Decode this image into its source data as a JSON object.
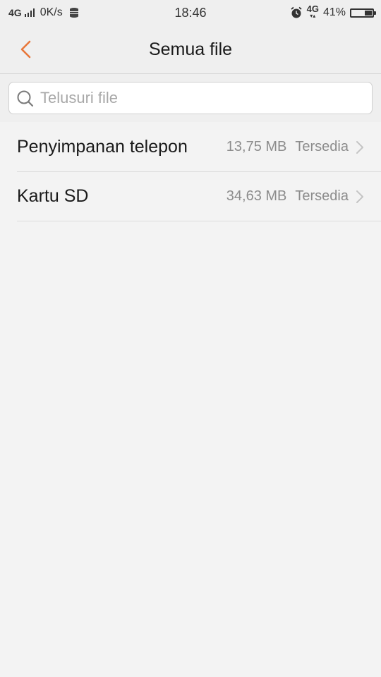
{
  "status_bar": {
    "network_left": "4G",
    "speed": "0K/s",
    "time": "18:46",
    "network_right": "4G",
    "battery_percent": "41%",
    "battery_level": 0.41
  },
  "header": {
    "title": "Semua file",
    "accent_color": "#e8773a"
  },
  "search": {
    "placeholder": "Telusuri file",
    "value": ""
  },
  "storage": {
    "items": [
      {
        "name": "Penyimpanan telepon",
        "size": "13,75 MB",
        "status": "Tersedia"
      },
      {
        "name": "Kartu SD",
        "size": "34,63 MB",
        "status": "Tersedia"
      }
    ]
  }
}
